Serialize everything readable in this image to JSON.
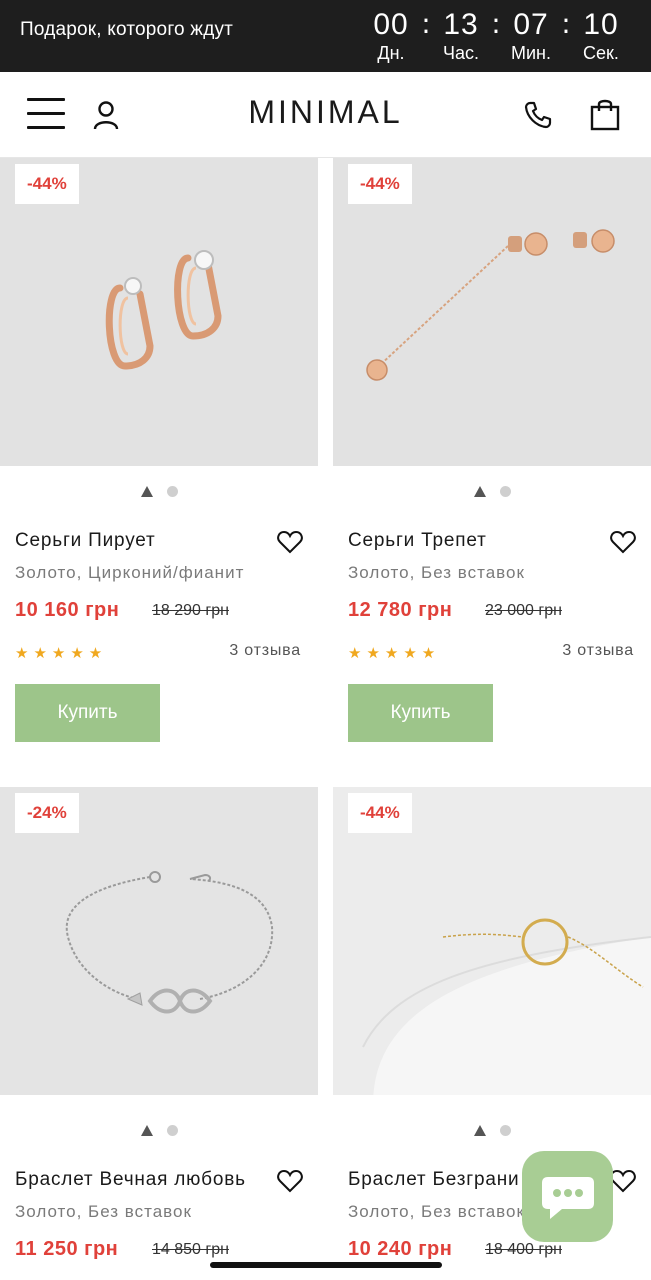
{
  "promo": {
    "text": "Подарок, которого ждут",
    "timer": [
      {
        "value": "00",
        "label": "Дн."
      },
      {
        "value": "13",
        "label": "Час."
      },
      {
        "value": "07",
        "label": "Мин."
      },
      {
        "value": "10",
        "label": "Сек."
      }
    ]
  },
  "header": {
    "logo": "MINIMAL",
    "icons": [
      "menu-icon",
      "user-icon",
      "phone-icon",
      "bag-icon"
    ]
  },
  "products": [
    {
      "badge": "-44%",
      "title": "Серьги Пирует",
      "subtitle": "Золото, Цирконий/фианит",
      "price": "10 160 грн",
      "old_price": "18 290 грн",
      "rating": 5,
      "stars": "★★★★★",
      "reviews": "3 отзыва",
      "buy_label": "Купить",
      "image_slide": 1,
      "image_slides": 2
    },
    {
      "badge": "-44%",
      "title": "Серьги Трепет",
      "subtitle": "Золото, Без вставок",
      "price": "12 780 грн",
      "old_price": "23 000 грн",
      "rating": 5,
      "stars": "★★★★★",
      "reviews": "3 отзыва",
      "buy_label": "Купить",
      "image_slide": 1,
      "image_slides": 2
    },
    {
      "badge": "-24%",
      "title": "Браслет Вечная любовь",
      "subtitle": "Золото, Без вставок",
      "price": "11 250 грн",
      "old_price": "14 850 грн",
      "image_slide": 1,
      "image_slides": 2
    },
    {
      "badge": "-44%",
      "title": "Браслет Безграни",
      "subtitle": "Золото, Без вставок",
      "price": "10 240 грн",
      "old_price": "18 400 грн",
      "image_slide": 1,
      "image_slides": 2
    }
  ],
  "colors": {
    "accent_red": "#e0413a",
    "buy_green": "#9dc58a",
    "star": "#f0a81f",
    "promo_bg": "#1e1e1e"
  },
  "chat": {
    "icon": "chat-bubble-icon"
  }
}
